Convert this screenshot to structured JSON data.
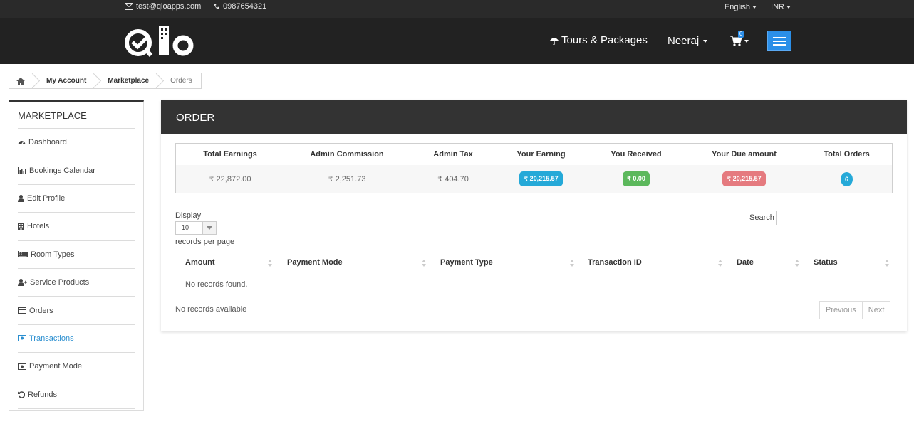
{
  "topbar": {
    "email": "test@qloapps.com",
    "phone": "0987654321",
    "language": "English",
    "currency": "INR"
  },
  "header": {
    "nav_tours": "Tours & Packages",
    "user_name": "Neeraj",
    "cart_count": "0",
    "accent_color": "#2b8fe8"
  },
  "breadcrumb": {
    "items": [
      "My Account",
      "Marketplace",
      "Orders"
    ]
  },
  "sidebar": {
    "title": "MARKETPLACE",
    "items": [
      {
        "label": "Dashboard",
        "icon": "dashboard-icon"
      },
      {
        "label": "Bookings Calendar",
        "icon": "bar-chart-icon"
      },
      {
        "label": "Edit Profile",
        "icon": "user-icon"
      },
      {
        "label": "Hotels",
        "icon": "building-icon"
      },
      {
        "label": "Room Types",
        "icon": "bed-icon"
      },
      {
        "label": "Service Products",
        "icon": "user-plus-icon"
      },
      {
        "label": "Orders",
        "icon": "credit-card-icon"
      },
      {
        "label": "Transactions",
        "icon": "money-icon"
      },
      {
        "label": "Payment Mode",
        "icon": "money-icon"
      },
      {
        "label": "Refunds",
        "icon": "undo-icon"
      }
    ],
    "active_item": "Transactions",
    "active_color": "#2b8fd0"
  },
  "main": {
    "title": "ORDER",
    "summary": {
      "headers": [
        "Total Earnings",
        "Admin Commission",
        "Admin Tax",
        "Your Earning",
        "You Received",
        "Your Due amount",
        "Total Orders"
      ],
      "total_earnings": "₹ 22,872.00",
      "admin_commission": "₹ 2,251.73",
      "admin_tax": "₹ 404.70",
      "your_earning": "₹ 20,215.57",
      "you_received": "₹ 0.00",
      "your_due_amount": "₹ 20,215.57",
      "total_orders": "6",
      "colors": {
        "earning": "#25a9d8",
        "received": "#5cb85c",
        "due": "#e57a7f",
        "orders": "#25a9d8"
      }
    },
    "table": {
      "display_label": "Display",
      "page_size": "10",
      "records_per_page_label": "records per page",
      "search_label": "Search",
      "search_value": "",
      "columns": [
        "Amount",
        "Payment Mode",
        "Payment Type",
        "Transaction ID",
        "Date",
        "Status"
      ],
      "empty_message": "No records found.",
      "info": "No records available",
      "prev_label": "Previous",
      "next_label": "Next"
    }
  }
}
